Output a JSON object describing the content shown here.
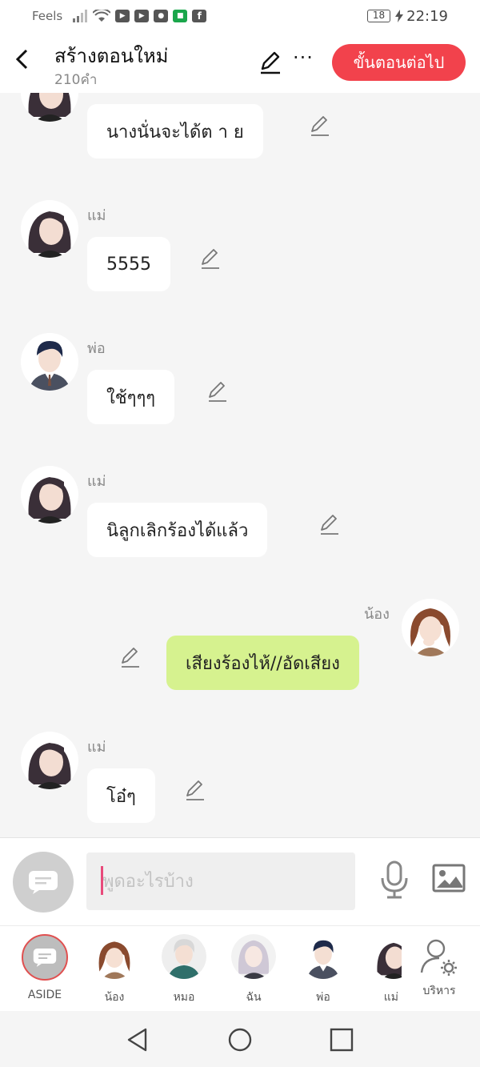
{
  "status_bar": {
    "carrier": "Feels",
    "battery": "18",
    "time": "22:19"
  },
  "header": {
    "title": "สร้างตอนใหม่",
    "word_count": "210คำ",
    "more_label": "···",
    "next_button": "ขั้นตอนต่อไป"
  },
  "messages": [
    {
      "side": "left",
      "sender": "",
      "text": "นางนั่นจะได้ต า ย",
      "avatar": "mom"
    },
    {
      "side": "left",
      "sender": "แม่",
      "text": "5555",
      "avatar": "mom"
    },
    {
      "side": "left",
      "sender": "พ่อ",
      "text": "ใช้ๆๆๆ",
      "avatar": "dad"
    },
    {
      "side": "left",
      "sender": "แม่",
      "text": "นิลูกเลิกร้องได้แล้ว",
      "avatar": "mom"
    },
    {
      "side": "right",
      "sender": "น้อง",
      "text": "เสียงร้องไห้//อัดเสียง",
      "avatar": "sister"
    },
    {
      "side": "left",
      "sender": "แม่",
      "text": "โอ๋ๆ",
      "avatar": "mom"
    }
  ],
  "composer": {
    "placeholder": "พูดอะไรบ้าง"
  },
  "characters": [
    {
      "label": "ASIDE",
      "avatar": "aside"
    },
    {
      "label": "น้อง",
      "avatar": "sister"
    },
    {
      "label": "หมอ",
      "avatar": "doctor"
    },
    {
      "label": "ฉัน",
      "avatar": "me"
    },
    {
      "label": "พ่อ",
      "avatar": "dad"
    },
    {
      "label": "แม่",
      "avatar": "mom"
    },
    {
      "label": "บริหาร",
      "avatar": "manage"
    }
  ],
  "colors": {
    "accent": "#f2424c",
    "my_bubble": "#d6f28f",
    "chat_bg": "#f5f5f5"
  }
}
